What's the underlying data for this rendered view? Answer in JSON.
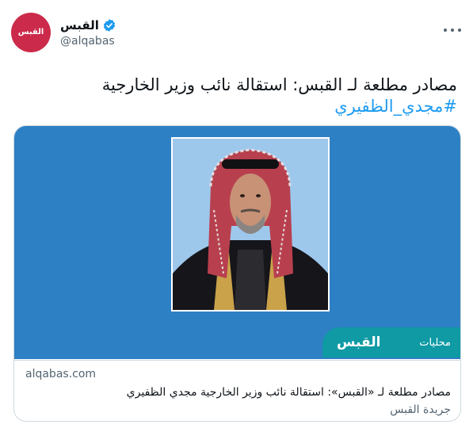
{
  "author": {
    "display_name": "القبس",
    "handle": "@alqabas",
    "avatar_text_1": "القبس",
    "avatar_text_2": "القبس",
    "verified_color": "#1d9bf0"
  },
  "tweet": {
    "text": "مصادر مطلعة لـ القبس: استقالة نائب وزير الخارجية",
    "hashtag": "#مجدي_الظفيري"
  },
  "card": {
    "banner_section": "محليات",
    "banner_logo": "القبس",
    "domain": "alqabas.com",
    "title": "مصادر مطلعة لـ «القبس»: استقالة نائب وزير الخارجية مجدي الظفيري",
    "description": "جريدة القبس"
  },
  "colors": {
    "card_background": "#2e80c4",
    "banner": "#0f9aa4",
    "avatar": "#cc2a4a",
    "link": "#1d9bf0"
  }
}
